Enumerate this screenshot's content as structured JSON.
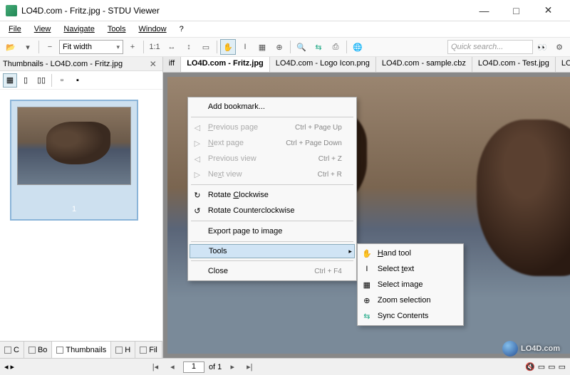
{
  "window": {
    "title": "LO4D.com - Fritz.jpg - STDU Viewer"
  },
  "menubar": [
    "File",
    "View",
    "Navigate",
    "Tools",
    "Window",
    "?"
  ],
  "menubar_underline": [
    0,
    0,
    0,
    0,
    0,
    null
  ],
  "toolbar": {
    "zoom_mode": "Fit width",
    "search_placeholder": "Quick search..."
  },
  "sidepanel": {
    "header": "Thumbnails - LO4D.com - Fritz.jpg",
    "thumb_number": "1",
    "bottom_tabs": [
      "C",
      "Bo",
      "Thumbnails",
      "H",
      "Fil"
    ]
  },
  "doctabs": {
    "left_overflow": "iff",
    "tabs": [
      "LO4D.com - Fritz.jpg",
      "LO4D.com - Logo Icon.png",
      "LO4D.com - sample.cbz",
      "LO4D.com - Test.jpg",
      "LO"
    ],
    "active_index": 0
  },
  "context_menu": {
    "items": [
      {
        "label": "Add bookmark...",
        "enabled": true
      },
      {
        "sep": true
      },
      {
        "label": "Previous page",
        "shortcut": "Ctrl + Page Up",
        "enabled": false,
        "icon": "◁",
        "underline": 0
      },
      {
        "label": "Next page",
        "shortcut": "Ctrl + Page Down",
        "enabled": false,
        "icon": "▷",
        "underline": 0
      },
      {
        "label": "Previous view",
        "shortcut": "Ctrl + Z",
        "enabled": false,
        "icon": "◁"
      },
      {
        "label": "Next view",
        "shortcut": "Ctrl + R",
        "enabled": false,
        "icon": "▷",
        "underline": 2
      },
      {
        "sep": true
      },
      {
        "label": "Rotate Clockwise",
        "enabled": true,
        "icon": "↻",
        "underline": 7
      },
      {
        "label": "Rotate Counterclockwise",
        "enabled": true,
        "icon": "↺"
      },
      {
        "sep": true
      },
      {
        "label": "Export page to image",
        "enabled": true
      },
      {
        "sep": true
      },
      {
        "label": "Tools",
        "enabled": true,
        "submenu": true,
        "selected": true
      },
      {
        "sep": true
      },
      {
        "label": "Close",
        "shortcut": "Ctrl + F4",
        "enabled": true
      }
    ]
  },
  "submenu": {
    "items": [
      {
        "label": "Hand tool",
        "icon": "✋",
        "underline": 0
      },
      {
        "label": "Select text",
        "icon": "I",
        "underline": 7
      },
      {
        "label": "Select image",
        "icon": "▦"
      },
      {
        "label": "Zoom selection",
        "icon": "⊕"
      },
      {
        "label": "Sync Contents",
        "icon": "⇆",
        "color": "#2a8"
      }
    ]
  },
  "status": {
    "page_current": "1",
    "page_total": "of 1"
  },
  "watermark": "LO4D.com"
}
